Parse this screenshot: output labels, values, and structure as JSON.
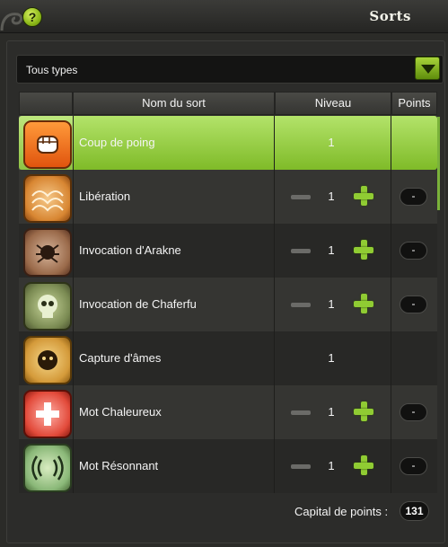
{
  "window": {
    "title": "Sorts"
  },
  "filter": {
    "selected": "Tous types"
  },
  "table": {
    "headers": {
      "name": "Nom du sort",
      "level": "Niveau",
      "points": "Points"
    },
    "rows": [
      {
        "name": "Coup de poing",
        "level": "1",
        "points": "",
        "icon": "fist-icon",
        "selected": true,
        "editable": false
      },
      {
        "name": "Libération",
        "level": "1",
        "points": "-",
        "icon": "liberation-icon",
        "selected": false,
        "editable": true
      },
      {
        "name": "Invocation d'Arakne",
        "level": "1",
        "points": "-",
        "icon": "arakne-icon",
        "selected": false,
        "editable": true
      },
      {
        "name": "Invocation de Chaferfu",
        "level": "1",
        "points": "-",
        "icon": "chaferfu-skull-icon",
        "selected": false,
        "editable": true
      },
      {
        "name": "Capture d'âmes",
        "level": "1",
        "points": "",
        "icon": "soul-capture-icon",
        "selected": false,
        "editable": false
      },
      {
        "name": "Mot Chaleureux",
        "level": "1",
        "points": "-",
        "icon": "heal-cross-icon",
        "selected": false,
        "editable": true
      },
      {
        "name": "Mot Résonnant",
        "level": "1",
        "points": "-",
        "icon": "resonance-waves-icon",
        "selected": false,
        "editable": true
      }
    ]
  },
  "footer": {
    "capital_label": "Capital de points :",
    "capital_value": "131"
  },
  "colors": {
    "accent": "#8cc63e",
    "selected_row": "#9bd052"
  }
}
